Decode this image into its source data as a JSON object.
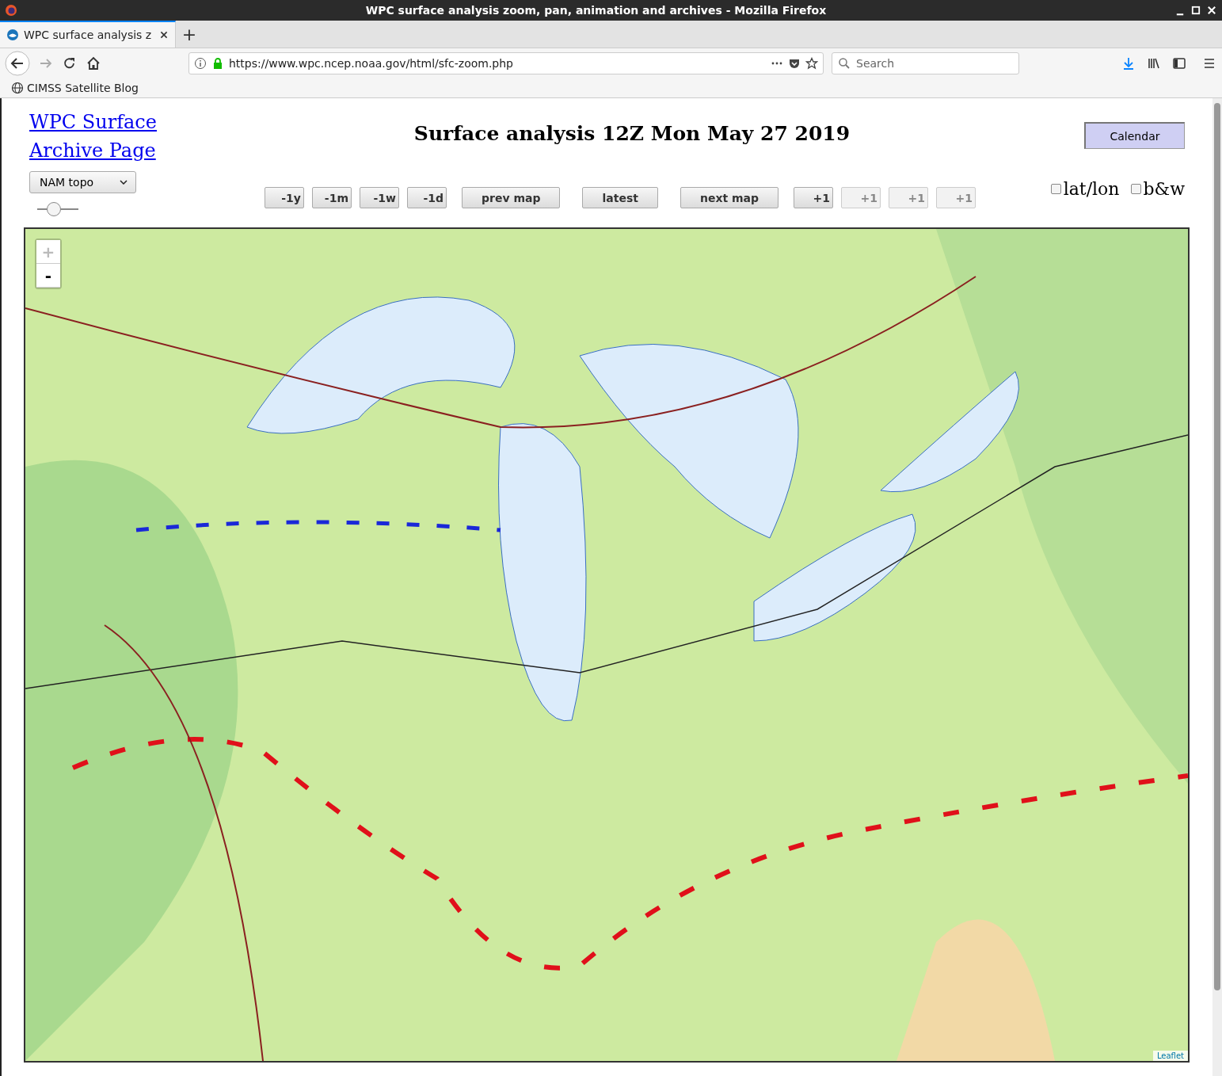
{
  "window": {
    "title": "WPC surface analysis zoom, pan, animation and archives - Mozilla Firefox"
  },
  "tabs": [
    {
      "label": "WPC surface analysis z",
      "selected": true
    }
  ],
  "new_tab": "+",
  "toolbar": {
    "url": "https://www.wpc.ncep.noaa.gov/html/sfc-zoom.php",
    "search": {
      "placeholder": "Search"
    }
  },
  "bookmarks": [
    {
      "label": "CIMSS Satellite Blog"
    }
  ],
  "page": {
    "home_link": "WPC Surface Archive Page",
    "heading": "Surface analysis 12Z Mon May 27 2019",
    "calendar_button": "Calendar",
    "map_select": {
      "value": "NAM topo"
    },
    "opacity_slider": {
      "level": 0.4
    },
    "nav_buttons": [
      {
        "label": "-1y",
        "disabled": false
      },
      {
        "label": "-1m",
        "disabled": false
      },
      {
        "label": "-1w",
        "disabled": false
      },
      {
        "label": "-1d",
        "disabled": false
      },
      {
        "label": "prev map",
        "disabled": false
      },
      {
        "label": "latest",
        "disabled": false
      },
      {
        "label": "next map",
        "disabled": false
      },
      {
        "label": "+1",
        "disabled": false
      },
      {
        "label": "+1",
        "disabled": true
      },
      {
        "label": "+1",
        "disabled": true
      },
      {
        "label": "+1",
        "disabled": true
      }
    ],
    "checkboxes": [
      {
        "label": "lat/lon",
        "checked": false
      },
      {
        "label": "b&w",
        "checked": false
      }
    ],
    "map": {
      "kind": "picture",
      "zoom_in": {
        "label": "+",
        "disabled": true
      },
      "zoom_out": {
        "label": "-",
        "disabled": false
      },
      "attribution": "Leaflet"
    }
  }
}
